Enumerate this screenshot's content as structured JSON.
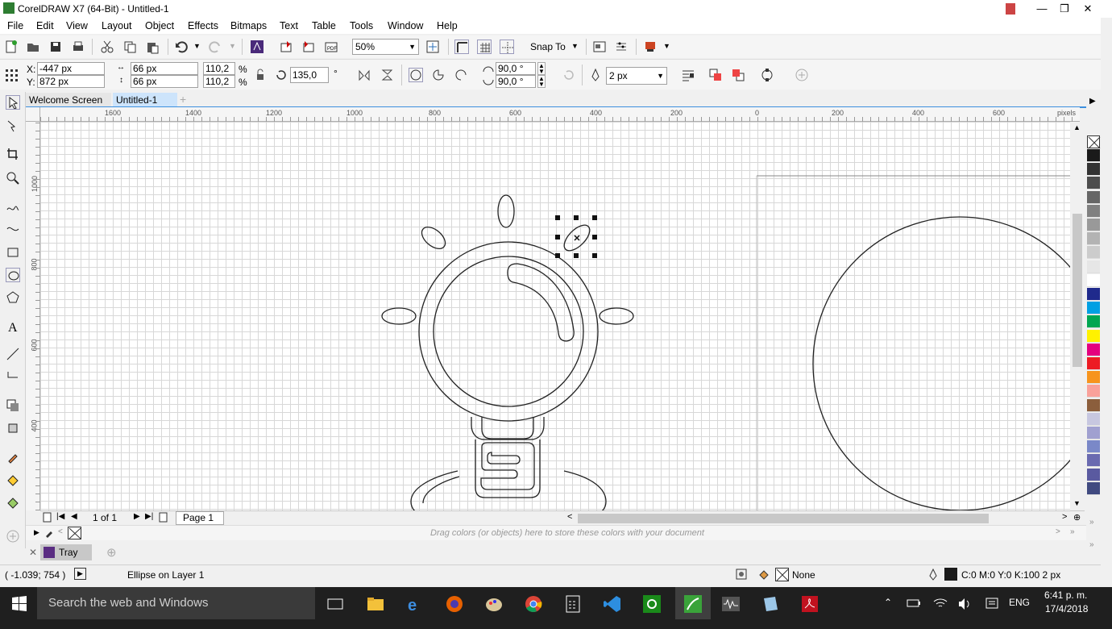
{
  "window": {
    "title": "CorelDRAW X7 (64-Bit) - Untitled-1"
  },
  "menu": [
    "File",
    "Edit",
    "View",
    "Layout",
    "Object",
    "Effects",
    "Bitmaps",
    "Text",
    "Table",
    "Tools",
    "Window",
    "Help"
  ],
  "toolbar": {
    "zoom": "50%",
    "snap_to": "Snap To"
  },
  "property_bar": {
    "x_label": "X:",
    "x_value": "-447 px",
    "y_label": "Y:",
    "y_value": "872 px",
    "width_value": "66 px",
    "height_value": "66 px",
    "scale_w": "110,2",
    "scale_h": "110,2",
    "pct": "%",
    "rotation": "135,0",
    "degree": "°",
    "angle_start": "90,0 °",
    "angle_end": "90,0 °",
    "outline_width": "2 px"
  },
  "tabs": [
    "Welcome Screen",
    "Untitled-1"
  ],
  "ruler": {
    "unit": "pixels",
    "h_ticks": [
      "1600",
      "1400",
      "1200",
      "1000",
      "800",
      "600",
      "400",
      "200",
      "0",
      "200",
      "400",
      "600"
    ],
    "v_ticks": [
      "1000",
      "800",
      "600",
      "400"
    ]
  },
  "page_nav": {
    "counter": "1 of 1",
    "page_tab": "Page 1"
  },
  "doc_palette": {
    "hint": "Drag colors (or objects) here to store these colors with your document"
  },
  "tray": {
    "label": "Tray"
  },
  "status": {
    "cursor": "( -1.039; 754   )",
    "selection": "Ellipse on Layer 1",
    "fill": "None",
    "outline": "C:0 M:0 Y:0 K:100  2 px"
  },
  "taskbar": {
    "search_placeholder": "Search the web and Windows",
    "lang": "ENG",
    "time": "6:41 p. m.",
    "date": "17/4/2018"
  },
  "palette_colors": [
    "#1a1a1a",
    "#333333",
    "#4d4d4d",
    "#666666",
    "#808080",
    "#999999",
    "#b3b3b3",
    "#cccccc",
    "#e6e6e6",
    "#ffffff",
    "#1f2a8c",
    "#00a0e3",
    "#00a651",
    "#fff200",
    "#e4007f",
    "#ed1c24",
    "#f7941d",
    "#f9a19a",
    "#8b5e3c",
    "#c7c7e0",
    "#a0a0d0",
    "#7a88c8",
    "#6a6ab0",
    "#5a5aa0",
    "#404a80"
  ]
}
